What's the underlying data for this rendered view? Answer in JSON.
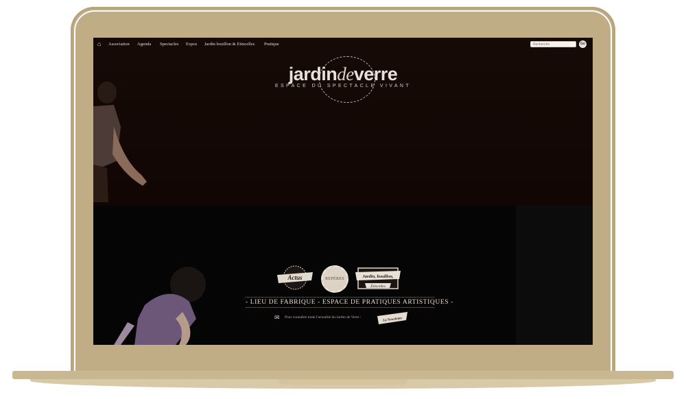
{
  "nav": {
    "home_icon": "home-icon",
    "items": [
      {
        "label": "Association"
      },
      {
        "label": "Agenda"
      },
      {
        "label": "Spectacles"
      },
      {
        "label": "Expos"
      },
      {
        "label": "Jardin bouillon & Etincelles"
      },
      {
        "label": "Pratique"
      }
    ],
    "search_placeholder": "Recherche",
    "go_label": "Go"
  },
  "logo": {
    "word_start": "jardin",
    "word_mid": "de",
    "word_end": "verre",
    "subtitle": "ESPACE DU SPECTACLE VIVANT"
  },
  "badges": {
    "actus": "Actus",
    "reperes": "REPÈRES",
    "jardin_line1": "Jardin, bouillon,",
    "jardin_line2": "Étincelles"
  },
  "tagline": "- LIEU DE FABRIQUE - ESPACE DE PRATIQUES ARTISTIQUES -",
  "newsletter": {
    "text": "Pour connaître toute l'actualité du Jardin de Verre :",
    "button": "La Newsletter"
  },
  "colors": {
    "frame": "#c0ad86",
    "screen_top": "#160a06",
    "screen_bottom": "#060505",
    "text_light": "#e6ddd2"
  }
}
